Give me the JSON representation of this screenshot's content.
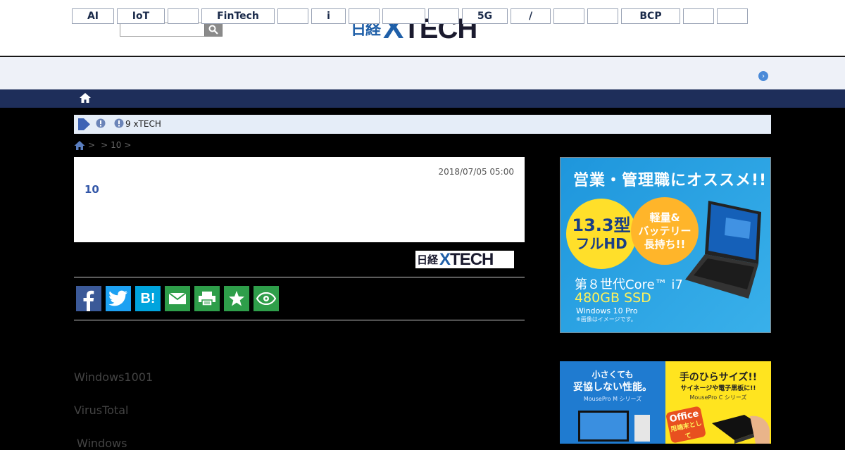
{
  "header": {
    "search_placeholder": "",
    "logo_jp": "日経",
    "logo_x": "X",
    "logo_text": "TECH"
  },
  "tags": [
    "AI",
    "IoT",
    "",
    "FinTech",
    "",
    "i",
    "",
    "",
    "",
    "5G",
    "/",
    "",
    "",
    "BCP",
    "",
    ""
  ],
  "alert": {
    "text": "9 xTECH"
  },
  "breadcrumb": {
    "sep1": ">",
    "sep2": ">",
    "item": "10",
    "sep3": ">"
  },
  "article": {
    "date": "2018/07/05 05:00",
    "title": "10",
    "source_jp": "日経",
    "source_x": "X",
    "source_text": "TECH"
  },
  "share_buttons": [
    {
      "name": "facebook",
      "label": "f",
      "color": "#3b5998"
    },
    {
      "name": "twitter",
      "label": "🐦",
      "color": "#1da1f2"
    },
    {
      "name": "hatena",
      "label": "B!",
      "color": "#00a4de"
    },
    {
      "name": "mail",
      "label": "✉",
      "color": "#2e9e4a"
    },
    {
      "name": "print",
      "label": "⎙",
      "color": "#2e9e4a"
    },
    {
      "name": "favorite",
      "label": "★",
      "color": "#2e9e4a"
    },
    {
      "name": "watch",
      "label": "👁",
      "color": "#2e9e4a"
    }
  ],
  "body": {
    "line1": "Windows1001",
    "line2": "VirusTotal",
    "line3": "Windows"
  },
  "ad1": {
    "headline": "営業・管理職にオススメ!!",
    "circle1_line1": "13.3型",
    "circle1_line2": "フルHD",
    "circle2_line1": "軽量&",
    "circle2_line2": "バッテリー",
    "circle2_line3": "長持ち!!",
    "cpu": "第８世代Core™ i7",
    "ssd": "480GB SSD",
    "os": "Windows 10 Pro",
    "note": "※画像はイメージです。"
  },
  "ad2": {
    "left_line1": "小さくても",
    "left_line2": "妥協しない性能。",
    "left_line3": "MousePro M シリーズ",
    "right_line1": "手のひらサイズ!!",
    "right_line2": "サイネージや電子黒板に!!",
    "right_line3": "MousePro C シリーズ",
    "office_line1": "Office",
    "office_line2": "用端末として"
  }
}
